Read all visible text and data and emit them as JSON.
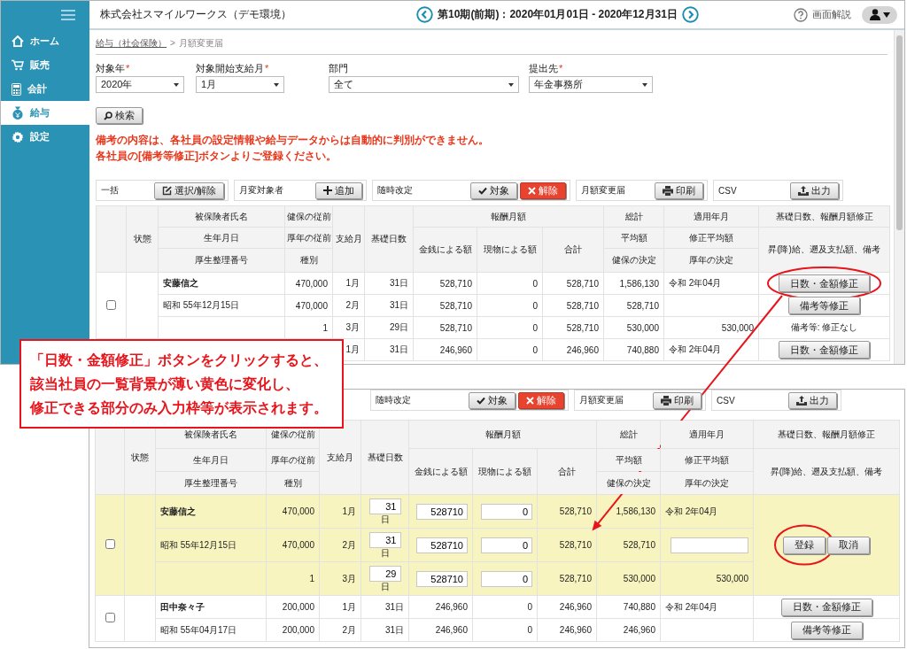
{
  "top_screen": {
    "sidebar": {
      "items": [
        {
          "label": "ホーム",
          "kind": "home",
          "selected": false
        },
        {
          "label": "販売",
          "kind": "cart",
          "selected": false
        },
        {
          "label": "会計",
          "kind": "calculator",
          "selected": false
        },
        {
          "label": "給与",
          "kind": "moneybag",
          "selected": true
        },
        {
          "label": "設定",
          "kind": "gear",
          "selected": false
        }
      ]
    },
    "header": {
      "company": "株式会社スマイルワークス（デモ環境）",
      "period": "第10期(前期)：2020年01月01日 - 2020年12月31日",
      "help": "画面解説"
    },
    "breadcrumb": {
      "items": [
        {
          "label": "給与（社会保険）",
          "link": true
        },
        {
          "label": "月額変更届",
          "link": false
        }
      ],
      "separator": ">"
    },
    "filters": [
      {
        "label": "対象年",
        "mark": "*",
        "value": "2020年"
      },
      {
        "label": "対象開始支給月",
        "mark": "*",
        "value": "1月"
      },
      {
        "label": "部門",
        "value": "全て"
      },
      {
        "label": "提出先",
        "mark": "*",
        "value": "年金事務所"
      }
    ],
    "search_button": "検索",
    "notice": [
      "備考の内容は、各社員の設定情報や給与データからは自動的に判別ができません。",
      "各社員の[備考等修正]ボタンよりご登録ください。"
    ],
    "toolbar": [
      {
        "label": "一括",
        "buttons": [
          {
            "label": "選択/解除",
            "kind": "select"
          }
        ]
      },
      {
        "label": "月変対象者",
        "buttons": [
          {
            "label": "追加",
            "kind": "add"
          }
        ]
      },
      {
        "label": "随時改定",
        "buttons": [
          {
            "label": "対象",
            "kind": "apply"
          },
          {
            "label": "解除",
            "kind": "cancel"
          }
        ]
      },
      {
        "label": "月額変更届",
        "buttons": [
          {
            "label": "印刷",
            "kind": "print"
          }
        ]
      },
      {
        "label": "CSV",
        "buttons": [
          {
            "label": "出力",
            "kind": "export"
          }
        ]
      }
    ],
    "table": {
      "header": [
        "状態",
        "被保険者氏名",
        "健保の従前",
        "支給月",
        "基礎日数",
        "報酬月額",
        "総計",
        "適用年月",
        "基礎日数、報酬月額修正",
        "生年月日",
        "厚年の従前",
        "金銭による額",
        "現物による額",
        "合計",
        "平均額",
        "修正平均額",
        "昇(降)給、遡及支払額、備考",
        "厚生整理番号",
        "種別",
        "健保の決定",
        "厚年の決定"
      ],
      "employees": [
        {
          "checked": false,
          "editing": false,
          "lines": [
            {
              "cells": [
                "安藤信之",
                "470,000",
                "1月",
                "31日",
                "528,710",
                "0",
                "528,710",
                "1,586,130",
                "令和 2年04月"
              ],
              "action": {
                "kind": "button",
                "label": "日数・金額修正"
              }
            },
            {
              "cells": [
                "昭和 55年12月15日",
                "470,000",
                "2月",
                "31日",
                "528,710",
                "0",
                "528,710",
                "528,710",
                null
              ],
              "action": {
                "kind": "button",
                "label": "備考等修正"
              }
            },
            {
              "cells": [
                null,
                "1",
                "3月",
                "29日",
                "528,710",
                "0",
                "528,710",
                "530,000",
                "530,000"
              ],
              "action": {
                "kind": "note",
                "text": "備考等: 修正なし"
              }
            }
          ]
        },
        {
          "editing": false,
          "lines": [
            {
              "cells": [
                null,
                null,
                "1月",
                "31日",
                "246,960",
                "0",
                "246,960",
                "740,880",
                "令和 2年04月"
              ],
              "action": {
                "kind": "button",
                "label": "日数・金額修正"
              }
            }
          ]
        }
      ]
    }
  },
  "bottom_screen": {
    "toolbar": [
      {
        "label": "随時改定",
        "buttons": [
          {
            "label": "対象",
            "kind": "apply"
          },
          {
            "label": "解除",
            "kind": "cancel"
          }
        ]
      },
      {
        "label": "月額変更届",
        "buttons": [
          {
            "label": "印刷",
            "kind": "print"
          }
        ]
      },
      {
        "label": "CSV",
        "buttons": [
          {
            "label": "出力",
            "kind": "export"
          }
        ]
      }
    ],
    "table": {
      "header": [
        "状態",
        "被保険者氏名",
        "健保の従前",
        "支給月",
        "基礎日数",
        "報酬月額",
        "総計",
        "適用年月",
        "基礎日数、報酬月額修正",
        "生年月日",
        "厚年の従前",
        "金銭による額",
        "現物による額",
        "合計",
        "平均額",
        "修正平均額",
        "昇(降)給、遡及支払額、備考",
        "厚生整理番号",
        "種別",
        "健保の決定",
        "厚年の決定"
      ],
      "employees": [
        {
          "checked": false,
          "editing": true,
          "edit_buttons": [
            {
              "label": "登録"
            },
            {
              "label": "取消"
            }
          ],
          "lines": [
            {
              "cells": [
                "安藤信之",
                "470,000",
                "1月",
                {
                  "kind": "input",
                  "value": "31",
                  "unit": "日"
                },
                {
                  "kind": "input",
                  "value": "528710"
                },
                {
                  "kind": "input",
                  "value": "0"
                },
                "528,710",
                "1,586,130",
                "令和 2年04月"
              ]
            },
            {
              "cells": [
                "昭和 55年12月15日",
                "470,000",
                "2月",
                {
                  "kind": "input",
                  "value": "31",
                  "unit": "日"
                },
                {
                  "kind": "input",
                  "value": "528710"
                },
                {
                  "kind": "input",
                  "value": "0"
                },
                "528,710",
                "528,710",
                {
                  "kind": "input"
                }
              ]
            },
            {
              "cells": [
                null,
                "1",
                "3月",
                {
                  "kind": "input",
                  "value": "29",
                  "unit": "日"
                },
                {
                  "kind": "input",
                  "value": "528710"
                },
                {
                  "kind": "input",
                  "value": "0"
                },
                "528,710",
                "530,000",
                "530,000"
              ]
            }
          ]
        },
        {
          "checked": false,
          "editing": false,
          "lines": [
            {
              "cells": [
                "田中奈々子",
                "200,000",
                "1月",
                "31日",
                "246,960",
                "0",
                "246,960",
                "740,880",
                "令和 2年04月"
              ],
              "action": {
                "kind": "button",
                "label": "日数・金額修正"
              }
            },
            {
              "cells": [
                "昭和 55年04月17日",
                "200,000",
                "2月",
                "31日",
                "246,960",
                "0",
                "246,960",
                "246,960",
                null
              ],
              "action": {
                "kind": "button",
                "label": "備考等修正"
              }
            }
          ]
        }
      ]
    }
  },
  "callout": {
    "lines": [
      "「日数・金額修正」ボタンをクリックすると、",
      "該当社員の一覧背景が薄い黄色に変化し、",
      "修正できる部分のみ入力枠等が表示されます。"
    ]
  }
}
